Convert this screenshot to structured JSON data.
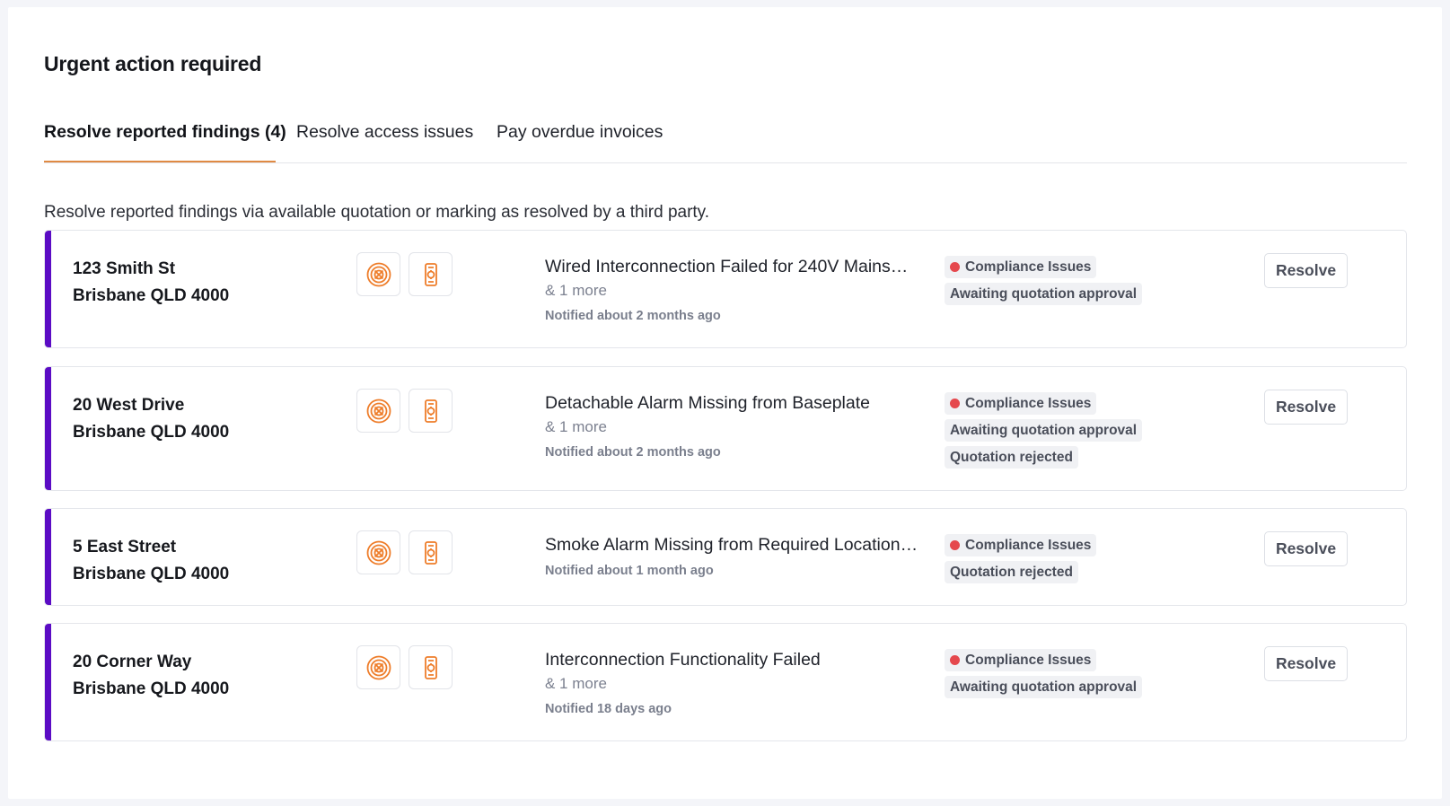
{
  "page": {
    "title": "Urgent action required",
    "description": "Resolve reported findings via available quotation or marking as resolved by a third party."
  },
  "tabs": [
    {
      "label": "Resolve reported findings (4)",
      "active": true
    },
    {
      "label": "Resolve access issues",
      "active": false
    },
    {
      "label": "Pay overdue invoices",
      "active": false
    }
  ],
  "colors": {
    "accent_bar": "#5b0cc4",
    "tab_underline": "#e08a43",
    "icon_orange": "#ee7d2a",
    "status_dot": "#e5484d"
  },
  "icons": [
    "smoke-alarm-icon",
    "alarm-device-icon"
  ],
  "cards": [
    {
      "street": "123 Smith St",
      "suburb": "Brisbane QLD 4000",
      "finding": "Wired Interconnection Failed for 240V Mains…",
      "more": "& 1 more",
      "notified": "Notified about 2 months ago",
      "tags": [
        "Compliance Issues",
        "Awaiting quotation approval"
      ],
      "action": "Resolve"
    },
    {
      "street": "20 West Drive",
      "suburb": "Brisbane QLD 4000",
      "finding": "Detachable Alarm Missing from Baseplate",
      "more": "& 1 more",
      "notified": "Notified about 2 months ago",
      "tags": [
        "Compliance Issues",
        "Awaiting quotation approval",
        "Quotation rejected"
      ],
      "action": "Resolve"
    },
    {
      "street": "5 East Street",
      "suburb": "Brisbane QLD 4000",
      "finding": "Smoke Alarm Missing from Required Location…",
      "more": "",
      "notified": "Notified about 1 month ago",
      "tags": [
        "Compliance Issues",
        "Quotation rejected"
      ],
      "action": "Resolve"
    },
    {
      "street": "20 Corner Way",
      "suburb": "Brisbane QLD 4000",
      "finding": "Interconnection Functionality Failed",
      "more": "& 1 more",
      "notified": "Notified 18 days ago",
      "tags": [
        "Compliance Issues",
        "Awaiting quotation approval"
      ],
      "action": "Resolve"
    }
  ]
}
